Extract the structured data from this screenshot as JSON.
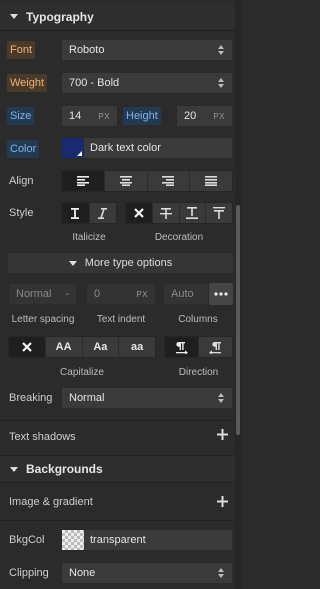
{
  "typography": {
    "title": "Typography",
    "font": {
      "label": "Font",
      "value": "Roboto"
    },
    "weight": {
      "label": "Weight",
      "value": "700 - Bold"
    },
    "size": {
      "label": "Size",
      "value": "14",
      "unit": "PX"
    },
    "height": {
      "label": "Height",
      "value": "20",
      "unit": "PX"
    },
    "color": {
      "label": "Color",
      "value": "Dark text color",
      "swatch": "#1b2a6e"
    },
    "align": {
      "label": "Align"
    },
    "style": {
      "label": "Style",
      "italicize": "Italicize",
      "decoration": "Decoration"
    },
    "more_options": "More type options",
    "letter_spacing": {
      "value": "Normal",
      "sep": "-",
      "caption": "Letter spacing"
    },
    "text_indent": {
      "value": "0",
      "unit": "PX",
      "caption": "Text indent"
    },
    "columns": {
      "value": "Auto",
      "caption": "Columns"
    },
    "capitalize": {
      "caption": "Capitalize",
      "opt_upper": "AA",
      "opt_title": "Aa",
      "opt_lower": "aa"
    },
    "direction": {
      "caption": "Direction"
    },
    "breaking": {
      "label": "Breaking",
      "value": "Normal"
    },
    "text_shadows": "Text shadows"
  },
  "backgrounds": {
    "title": "Backgrounds",
    "image_gradient": "Image & gradient",
    "bkgcol": {
      "label": "BkgCol",
      "value": "transparent"
    },
    "clipping": {
      "label": "Clipping",
      "value": "None"
    }
  },
  "colors": {
    "accent_orange": "#f0b27a",
    "accent_blue": "#7fb4e8"
  }
}
